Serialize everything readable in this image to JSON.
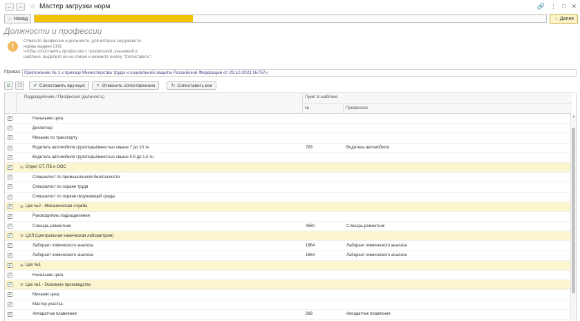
{
  "window": {
    "title": "Мастер загрузки норм",
    "nav_back_icon": "←",
    "nav_forward_icon": "→",
    "star_icon": "☆",
    "window_icons": [
      "🔗",
      "⋮",
      "□",
      "✕"
    ]
  },
  "wizard": {
    "back_label": "Назад",
    "next_label": "Далее",
    "progress_fraction": 0.31
  },
  "page": {
    "title": "Должности и профессии",
    "hint_lines": [
      "Отметьте профессии и должности, для которых загружаются",
      "нормы выдачи СИЗ.",
      "Чтобы сопоставить профессию с профессией, указанной в",
      "шаблоне, выделите ее на списке и нажмите кнопку \"Сопоставить\"."
    ]
  },
  "order": {
    "label": "Приказ:",
    "value": "Приложение № 1 к приказу Министерства труда и социальной защиты Российской Федерации от 29.10.2021 №767н"
  },
  "toolbar": {
    "match_manual_label": "Сопоставить вручную",
    "cancel_match_label": "Отменить сопоставление",
    "match_all_label": "Сопоставить все"
  },
  "table": {
    "col_name": "Подразделение / Профессия (должность)",
    "col_template_point": "Пункт в шаблоне",
    "col_number": "№",
    "col_profession": "Профессия",
    "rows": [
      {
        "group": false,
        "name": "Начальник цеха",
        "num": "",
        "prof": ""
      },
      {
        "group": false,
        "name": "Диспетчер",
        "num": "",
        "prof": ""
      },
      {
        "group": false,
        "name": "Механик по транспорту",
        "num": "",
        "prof": ""
      },
      {
        "group": false,
        "name": "Водитель автомобиля грузоподъёмностью свыше 7 до 10 тн",
        "num": "783",
        "prof": "Водитель автомобиля"
      },
      {
        "group": false,
        "name": "Водитель автомобиля грузоподъёмностью свыше 0,5 до 1,5 тн",
        "num": "",
        "prof": ""
      },
      {
        "group": true,
        "name": "Отдел ОТ, ПБ и ООС",
        "num": "",
        "prof": ""
      },
      {
        "group": false,
        "name": "Специалист по промышленной безопасности",
        "num": "",
        "prof": ""
      },
      {
        "group": false,
        "name": "Специалист по охране труда",
        "num": "",
        "prof": ""
      },
      {
        "group": false,
        "name": "Специалист по охране окружающей среды",
        "num": "",
        "prof": ""
      },
      {
        "group": true,
        "name": "Цех №2 - Механическая служба",
        "num": "",
        "prof": ""
      },
      {
        "group": false,
        "name": "Руководитель подразделения",
        "num": "",
        "prof": ""
      },
      {
        "group": false,
        "name": "Слесарь-ремонтник",
        "num": "4560",
        "prof": "Слесарь-ремонтник"
      },
      {
        "group": true,
        "name": "ЦХЛ (Центральная химическая лаборатория)",
        "num": "",
        "prof": ""
      },
      {
        "group": false,
        "name": "Лаборант химического анализа",
        "num": "1864",
        "prof": "Лаборант химического анализа"
      },
      {
        "group": false,
        "name": "Лаборант химического анализа",
        "num": "1864",
        "prof": "Лаборант химического анализа"
      },
      {
        "group": true,
        "name": "Цех №1",
        "num": "",
        "prof": ""
      },
      {
        "group": false,
        "name": "Начальник цеха",
        "num": "",
        "prof": ""
      },
      {
        "group": true,
        "name": "Цех №1 - Основное производство",
        "num": "",
        "prof": ""
      },
      {
        "group": false,
        "name": "Механик цеха",
        "num": "",
        "prof": ""
      },
      {
        "group": false,
        "name": "Мастер участка",
        "num": "",
        "prof": ""
      },
      {
        "group": false,
        "name": "Аппаратчик плавления",
        "num": "268",
        "prof": "Аппаратчик плавления"
      }
    ]
  }
}
